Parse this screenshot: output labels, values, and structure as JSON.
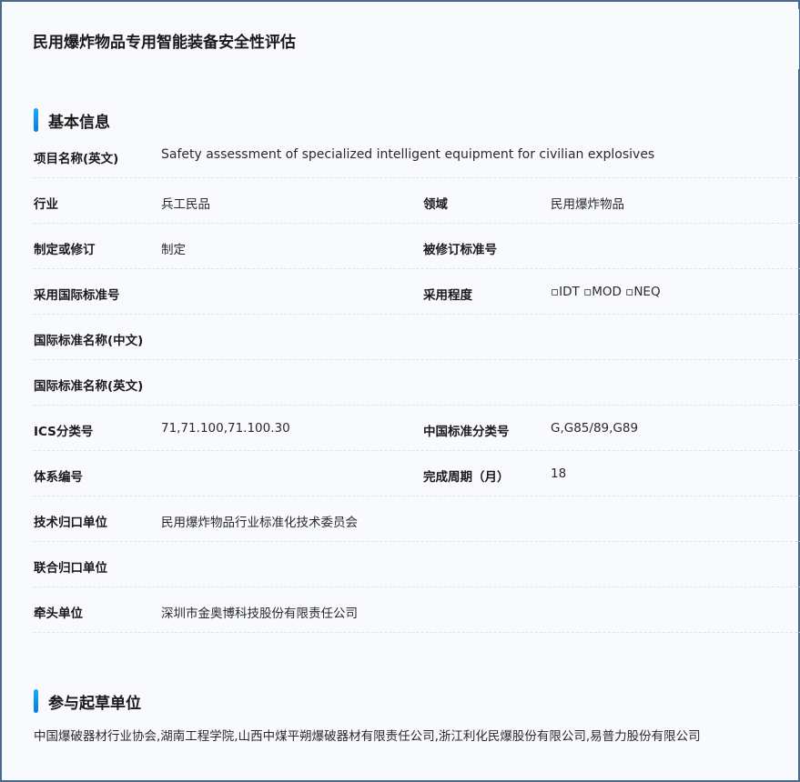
{
  "page": {
    "title": "民用爆炸物品专用智能装备安全性评估"
  },
  "basic_info": {
    "heading": "基本信息",
    "project_name_en_label": "项目名称(英文)",
    "project_name_en_value": "Safety assessment of specialized intelligent equipment for civilian explosives",
    "industry_label": "行业",
    "industry_value": "兵工民品",
    "field_label": "领域",
    "field_value": "民用爆炸物品",
    "formulate_label": "制定或修订",
    "formulate_value": "制定",
    "revised_std_no_label": "被修订标准号",
    "revised_std_no_value": "",
    "intl_std_no_label": "采用国际标准号",
    "intl_std_no_value": "",
    "adoption_degree_label": "采用程度",
    "adoption_degree_value": "▫IDT ▫MOD ▫NEQ",
    "intl_std_name_cn_label": "国际标准名称(中文)",
    "intl_std_name_cn_value": "",
    "intl_std_name_en_label": "国际标准名称(英文)",
    "intl_std_name_en_value": "",
    "ics_label": "ICS分类号",
    "ics_value": "71,71.100,71.100.30",
    "ccs_label": "中国标准分类号",
    "ccs_value": "G,G85/89,G89",
    "system_no_label": "体系编号",
    "system_no_value": "",
    "cycle_label": "完成周期（月）",
    "cycle_value": "18",
    "tech_unit_label": "技术归口单位",
    "tech_unit_value": "民用爆炸物品行业标准化技术委员会",
    "joint_unit_label": "联合归口单位",
    "joint_unit_value": "",
    "lead_unit_label": "牵头单位",
    "lead_unit_value": "深圳市金奥博科技股份有限责任公司"
  },
  "drafting": {
    "heading": "参与起草单位",
    "units": "中国爆破器材行业协会,湖南工程学院,山西中煤平朔爆破器材有限责任公司,浙江利化民爆股份有限公司,易普力股份有限公司"
  }
}
